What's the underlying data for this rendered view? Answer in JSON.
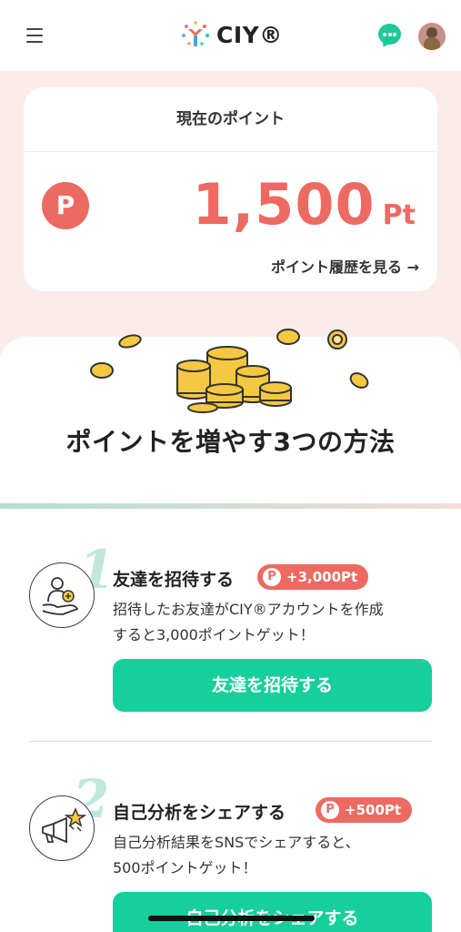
{
  "header": {
    "logo_text": "CIY®",
    "menu_icon": "hamburger-menu-icon",
    "chat_icon": "chat-bubble-icon",
    "avatar": "user-avatar"
  },
  "points_card": {
    "title": "現在のポイント",
    "icon_letter": "P",
    "value": "1,500",
    "unit": "Pt",
    "history_link": "ポイント履歴を見る →"
  },
  "section": {
    "heading": "ポイントを増やす3つの方法"
  },
  "methods": [
    {
      "number": "1",
      "title": "友達を招待する",
      "badge": "+3,000Pt",
      "description_lines": [
        "招待したお友達がCIY®アカウントを作成",
        "すると3,000ポイントゲット！"
      ],
      "button": "友達を招待する",
      "icon": "invite-friend-icon"
    },
    {
      "number": "2",
      "title": "自己分析をシェアする",
      "badge": "+500Pt",
      "description_lines": [
        "自己分析結果をSNSでシェアすると、",
        "500ポイントゲット！"
      ],
      "button": "自己分析をシェアする",
      "icon": "megaphone-share-icon"
    }
  ],
  "colors": {
    "accent_red": "#ec6a62",
    "accent_green": "#16cf9c",
    "background_pink": "#fbece9"
  }
}
